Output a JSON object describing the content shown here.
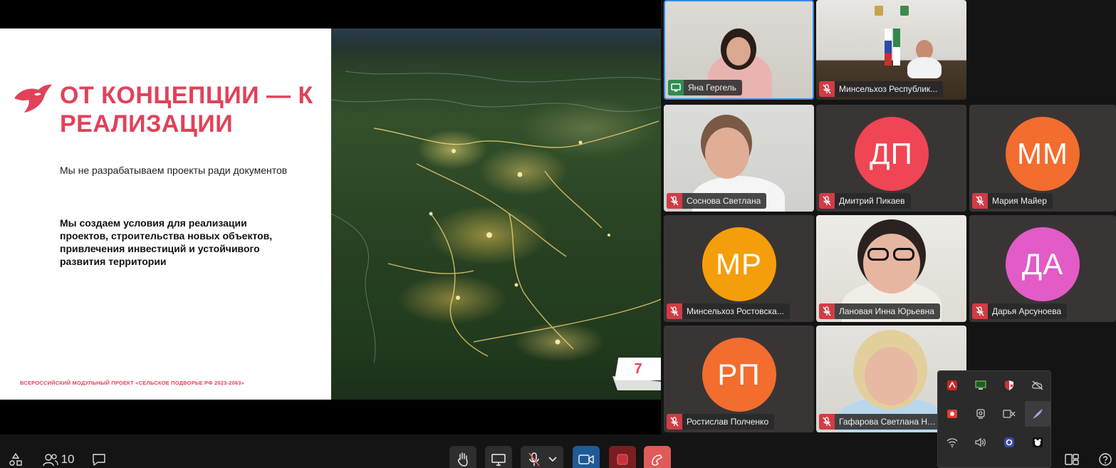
{
  "slide": {
    "title": "ОТ КОНЦЕПЦИИ — К РЕАЛИЗАЦИИ",
    "subtitle": "Мы не разрабатываем проекты ради документов",
    "bold_text": "Мы создаем условия для реализации проектов, строительства новых объектов, привлечения инвестиций и устойчивого развития территории",
    "footer": "ВСЕРОССИЙСКИЙ МОДУЛЬНЫЙ ПРОЕКТ «СЕЛЬСКОЕ ПОДВОРЬЕ РФ 2023-2063»",
    "page_number": "7",
    "accent_color": "#e2415a"
  },
  "participants": [
    {
      "name": "Яна Гергель",
      "status": "screen-share-icon",
      "avatar": ""
    },
    {
      "name": "Минсельхоз Республик...",
      "status": "mic-off-icon",
      "avatar": ""
    },
    {
      "name": "Соснова Светлана",
      "status": "mic-off-icon",
      "avatar": ""
    },
    {
      "name": "Дмитрий Пикаев",
      "status": "mic-off-icon",
      "avatar": "ДП"
    },
    {
      "name": "Мария Майер",
      "status": "mic-off-icon",
      "avatar": "ММ"
    },
    {
      "name": "Минсельхоз Ростовска...",
      "status": "mic-off-icon",
      "avatar": "МР"
    },
    {
      "name": "Лановая Инна Юрьевна",
      "status": "mic-off-icon",
      "avatar": ""
    },
    {
      "name": "Дарья Арсуноева",
      "status": "mic-off-icon",
      "avatar": "ДА"
    },
    {
      "name": "Ростислав Полченко",
      "status": "mic-off-icon",
      "avatar": "РП"
    },
    {
      "name": "Гафарова Светлана НА...",
      "status": "mic-off-icon",
      "avatar": ""
    }
  ],
  "toolbar": {
    "participants_count": "10",
    "icons": [
      "apps-icon",
      "participants-icon",
      "chat-icon",
      "raise-hand-icon",
      "screen-share-icon",
      "mic-off-icon",
      "chevron-down-icon",
      "camera-icon",
      "record-icon",
      "hang-up-icon",
      "layout-icon",
      "help-icon"
    ]
  },
  "tray": {
    "icons": [
      "antivirus-icon",
      "monitor-icon",
      "security-shield-icon",
      "cloud-off-icon",
      "recorder-icon",
      "webcam-icon",
      "keyboard-language-icon",
      "pen-icon",
      "wifi-icon",
      "volume-icon",
      "app-icon",
      "bear-app-icon"
    ]
  }
}
